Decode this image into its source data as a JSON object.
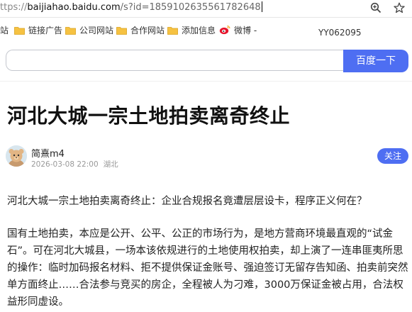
{
  "browser": {
    "url_prefix": "ttps://",
    "url_host": "baijiahao.baidu.com",
    "url_path": "/s?id=1859102635561782648",
    "zoom_icon": "zoom-icon",
    "star_icon": "star-icon"
  },
  "bookmarks": [
    {
      "label": "站",
      "icon": "folder-icon"
    },
    {
      "label": "链接广告",
      "icon": "folder-icon"
    },
    {
      "label": "公司网站",
      "icon": "folder-icon"
    },
    {
      "label": "合作网站",
      "icon": "folder-icon"
    },
    {
      "label": "添加信息",
      "icon": "folder-icon"
    },
    {
      "label": "微博 -",
      "icon": "weibo-icon"
    }
  ],
  "watermark": "YY062095",
  "search": {
    "value": "",
    "button_label": "百度一下"
  },
  "article": {
    "title": "河北大城一宗土地拍卖离奇终止",
    "author": "简熹m4",
    "date": "2026-03-08 22:00",
    "location": "湖北",
    "follow_label": "关注",
    "paragraphs": [
      "河北大城一宗土地拍卖离奇终止：企业合规报名竟遭层层设卡，程序正义何在？",
      "国有土地拍卖，本应是公开、公平、公正的市场行为，是地方营商环境最直观的“试金石”。可在河北大城县，一场本该依规进行的土地使用权拍卖，却上演了一连串匪夷所思的操作：临时加码报名材料、拒不提供保证金账号、强迫签订无留存告知函、拍卖前突然单方面终止……合法参与竞买的房企，全程被人为刁难，3000万保证金被占用，合法权益形同虚设。"
    ]
  }
}
